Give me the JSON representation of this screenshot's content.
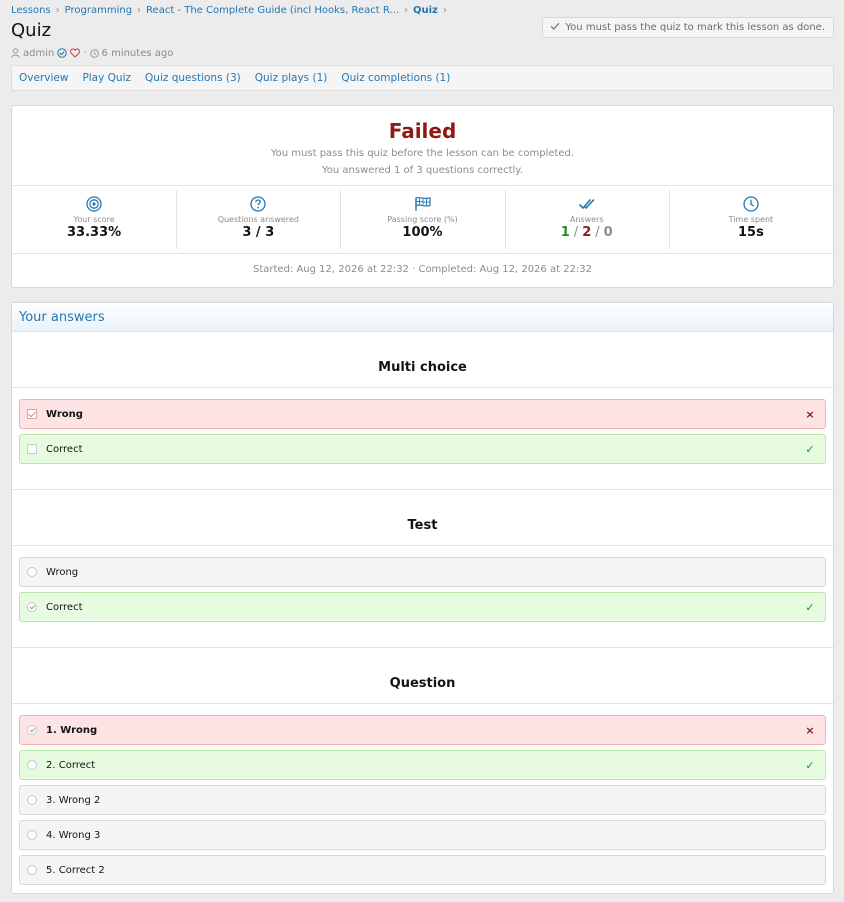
{
  "breadcrumb": [
    "Lessons",
    "Programming",
    "React - The Complete Guide (incl Hooks, React R...",
    "Quiz"
  ],
  "page_title": "Quiz",
  "meta": {
    "author": "admin",
    "separator": "·",
    "time_ago": "6 minutes ago"
  },
  "notice": "You must pass the quiz to mark this lesson as done.",
  "tabs": [
    "Overview",
    "Play Quiz",
    "Quiz questions (3)",
    "Quiz plays (1)",
    "Quiz completions (1)"
  ],
  "result": {
    "status": "Failed",
    "message": "You must pass this quiz before the lesson can be completed.",
    "summary": "You answered 1 of 3 questions correctly.",
    "stats": {
      "score": {
        "label": "Your score",
        "value": "33.33%",
        "icon": "target-icon"
      },
      "answered": {
        "label": "Questions answered",
        "value": "3 / 3",
        "icon": "question-icon"
      },
      "passing": {
        "label": "Passing score (%)",
        "value": "100%",
        "icon": "flag-icon"
      },
      "answers": {
        "label": "Answers",
        "correct": "1",
        "wrong": "2",
        "skipped": "0",
        "separator": "/",
        "icon": "double-check-icon"
      },
      "time": {
        "label": "Time spent",
        "value": "15s",
        "icon": "clock-icon"
      }
    },
    "timeline": "Started: Aug 12, 2026 at 22:32 · Completed: Aug 12, 2026 at 22:32"
  },
  "answers_title": "Your answers",
  "mark_wrong": "×",
  "mark_correct": "✓",
  "questions": [
    {
      "title": "Multi choice",
      "type": "checkbox",
      "options": [
        {
          "label": "Wrong",
          "state": "wrong",
          "selected": true
        },
        {
          "label": "Correct",
          "state": "correct",
          "selected": false
        }
      ]
    },
    {
      "title": "Test",
      "type": "radio",
      "options": [
        {
          "label": "Wrong",
          "state": "neutral",
          "selected": false
        },
        {
          "label": "Correct",
          "state": "correct",
          "selected": true
        }
      ]
    },
    {
      "title": "Question",
      "type": "radio",
      "options": [
        {
          "label": "1. Wrong",
          "state": "wrong",
          "selected": true
        },
        {
          "label": "2. Correct",
          "state": "correct",
          "selected": false
        },
        {
          "label": "3. Wrong 2",
          "state": "neutral",
          "selected": false
        },
        {
          "label": "4. Wrong 3",
          "state": "neutral",
          "selected": false
        },
        {
          "label": "5. Correct 2",
          "state": "neutral",
          "selected": false
        }
      ]
    }
  ],
  "colors": {
    "link": "#2577b1",
    "failed": "#8c1a16",
    "correct": "#1f8f1f",
    "wrong_bg": "#fde3e3",
    "correct_bg": "#e7fbe1"
  }
}
